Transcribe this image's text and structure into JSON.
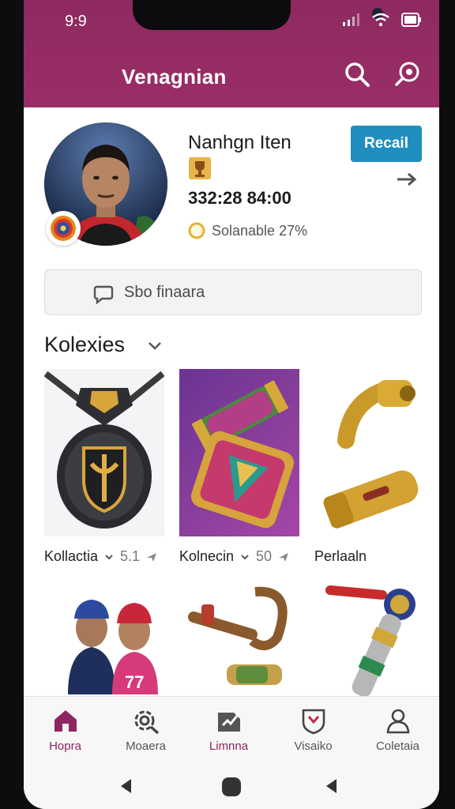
{
  "status_bar": {
    "time": "9:9"
  },
  "header": {
    "title": "Venagnian"
  },
  "profile": {
    "name": "Nanhgn Iten",
    "score": "332:28 84:00",
    "stat": "Solanable 27%",
    "recall_label": "Recail"
  },
  "search": {
    "text": "Sbo finaara"
  },
  "section": {
    "title": "Kolexies"
  },
  "cards": [
    {
      "label": "Kollactia",
      "value": "5.1"
    },
    {
      "label": "Kolnecin",
      "value": "50"
    },
    {
      "label": "Perlaaln",
      "value": ""
    }
  ],
  "bottom_nav": [
    {
      "label": "Hopra",
      "icon": "home-icon",
      "active": true
    },
    {
      "label": "Moaera",
      "icon": "settings-icon",
      "active": false
    },
    {
      "label": "Limnna",
      "icon": "edit-icon",
      "active": false
    },
    {
      "label": "Visaiko",
      "icon": "shield-icon",
      "active": false
    },
    {
      "label": "Coletaia",
      "icon": "person-icon",
      "active": false
    }
  ],
  "colors": {
    "header": "#8e2a60",
    "accent": "#8d2760",
    "button": "#1f8fbf"
  }
}
